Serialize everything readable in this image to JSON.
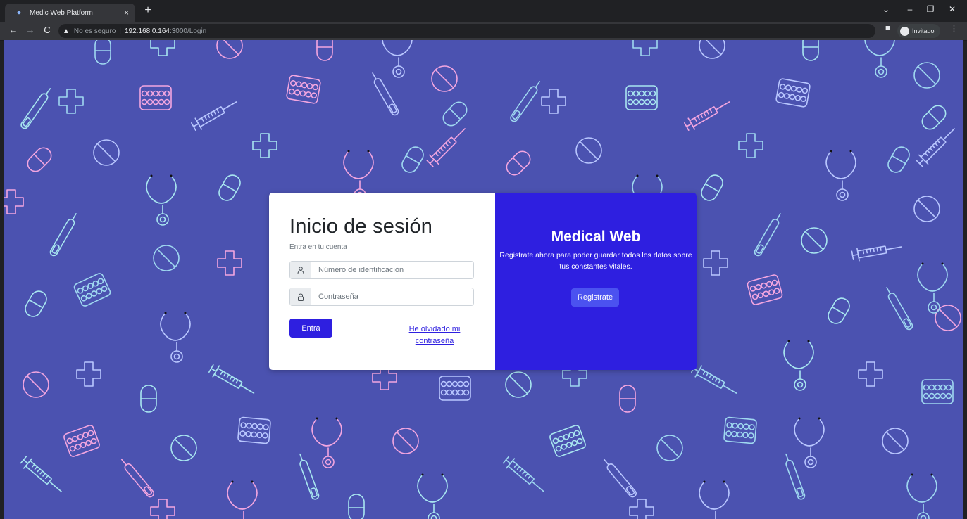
{
  "browser": {
    "tab_title": "Medic Web Platform",
    "tab_close": "×",
    "new_tab": "+",
    "security_label": "No es seguro",
    "url_host": "192.168.0.164",
    "url_path": ":3000/Login",
    "profile_label": "Invitado"
  },
  "login": {
    "title": "Inicio de sesión",
    "subtitle": "Entra en tu cuenta",
    "id_placeholder": "Número de identificación",
    "password_placeholder": "Contraseña",
    "submit_label": "Entra",
    "forgot_label": "He olvidado mi contraseña"
  },
  "register": {
    "title": "Medical Web",
    "text": "Registrate ahora para poder guardar todos los datos sobre tus constantes vitales.",
    "button_label": "Registrate"
  },
  "colors": {
    "page_bg": "#4b52b0",
    "accent": "#2e1fe0"
  },
  "icons": [
    "back-arrow-icon",
    "forward-arrow-icon",
    "reload-icon",
    "warning-icon",
    "user-icon",
    "lock-icon",
    "side-panel-icon",
    "profile-icon",
    "menu-icon"
  ]
}
